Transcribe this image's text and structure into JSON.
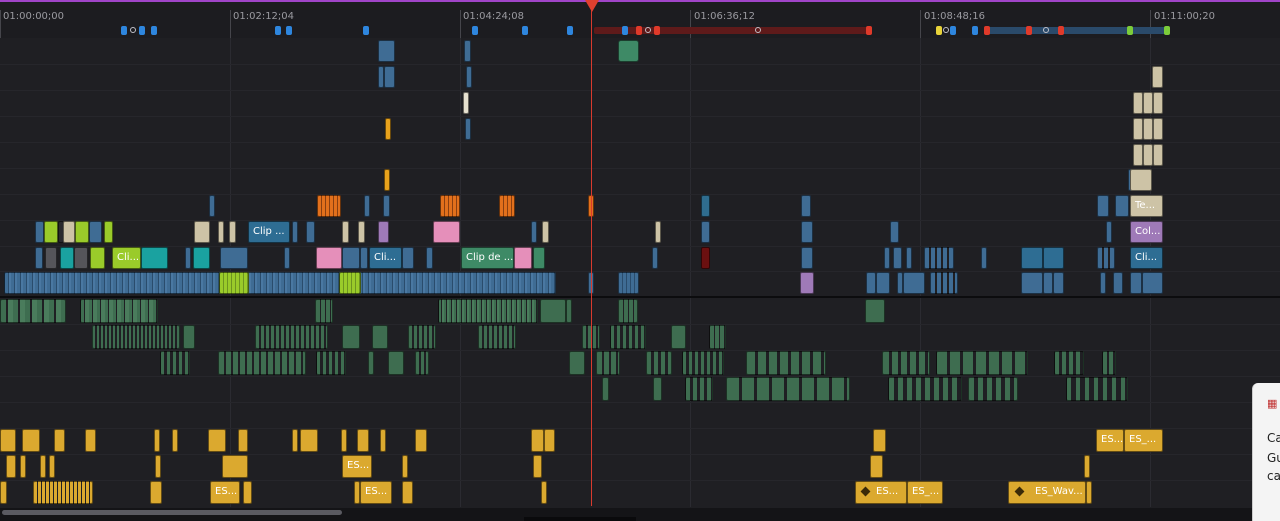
{
  "timecodes": [
    "01:00:00;00",
    "01:02:12;04",
    "01:04:24;08",
    "01:06:36;12",
    "01:08:48;16",
    "01:11:00;20"
  ],
  "clip_labels": {
    "clip_dots_1": "Clip ...",
    "cli_1": "Cli...",
    "cli_2": "Cli...",
    "clip_de": "Clip de ...",
    "te": "Te...",
    "col": "Col...",
    "cli_3": "Cli...",
    "es_1": "ES...",
    "es_2": "ES_...",
    "es_3": "ES...",
    "es_4": "ES...",
    "es_5": "ES...",
    "es_6": "ES...",
    "es_7": "ES_...",
    "es_wav": "ES_Wav..."
  },
  "notification_panel": {
    "icon": "notification-app-icon",
    "line1": "Ca",
    "line2": "Gu",
    "line3": "ca"
  },
  "colors": {
    "video_blue": "#3f6c94",
    "teal": "#1aa2a0",
    "lime": "#9acb2a",
    "orange": "#e2701c",
    "beige": "#cdc3a6",
    "pink": "#e58fba",
    "lavender": "#9f7ab8",
    "audio_green": "#3e6d50",
    "audio_yellow": "#dba92f",
    "playhead": "#d83a2e"
  }
}
